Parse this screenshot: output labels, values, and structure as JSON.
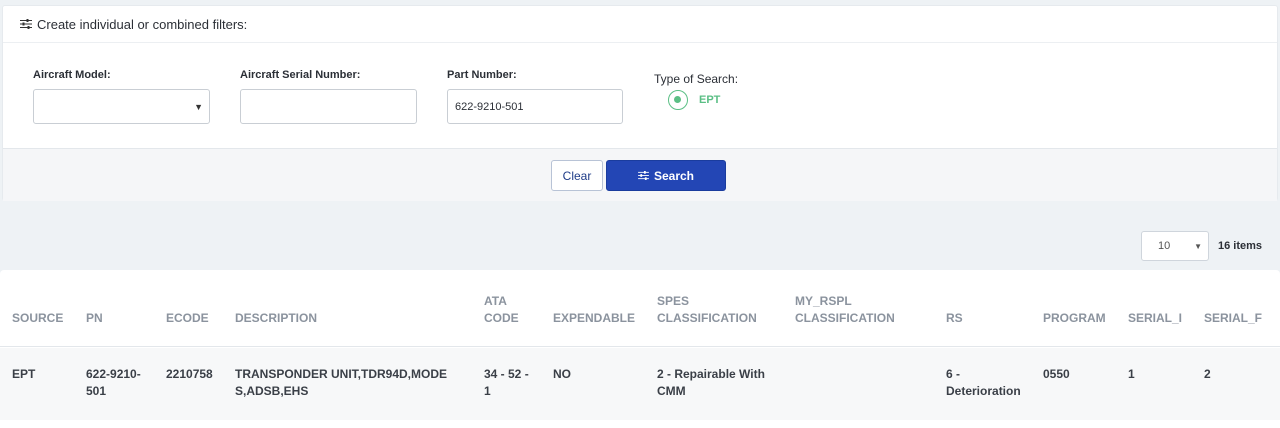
{
  "filters": {
    "header": "Create individual or combined filters:",
    "aircraft_model": {
      "label": "Aircraft Model:",
      "value": ""
    },
    "serial_number": {
      "label": "Aircraft Serial Number:",
      "value": ""
    },
    "part_number": {
      "label": "Part Number:",
      "value": "622-9210-501"
    },
    "search_type": {
      "label": "Type of Search:",
      "option": "EPT"
    }
  },
  "actions": {
    "clear": "Clear",
    "search": "Search"
  },
  "pagination": {
    "page_size": "10",
    "count": "16 items"
  },
  "table": {
    "headers": {
      "source": "SOURCE",
      "pn": "PN",
      "ecode": "ECODE",
      "description": "DESCRIPTION",
      "ata_1": "ATA",
      "ata_2": "CODE",
      "expendable": "EXPENDABLE",
      "spes_1": "SPES",
      "spes_2": "CLASSIFICATION",
      "rspl_1": "MY_RSPL",
      "rspl_2": "CLASSIFICATION",
      "rs": "RS",
      "program": "PROGRAM",
      "serial_i": "SERIAL_I",
      "serial_f": "SERIAL_F"
    },
    "row": {
      "source": "EPT",
      "pn_1": "622-9210-",
      "pn_2": "501",
      "ecode": "2210758",
      "desc_1": "TRANSPONDER UNIT,TDR94D,MODE",
      "desc_2": "S,ADSB,EHS",
      "ata_1": "34 - 52 -",
      "ata_2": "1",
      "expendable": "NO",
      "spes_1": "2 - Repairable With",
      "spes_2": "CMM",
      "rspl": "",
      "rs_1": "6 -",
      "rs_2": "Deterioration",
      "program": "0550",
      "serial_i": "1",
      "serial_f": "2"
    }
  },
  "colors": {
    "accent": "#2346b5",
    "radio": "#5bbf85"
  },
  "icons": {
    "filter": "sliders-icon"
  }
}
